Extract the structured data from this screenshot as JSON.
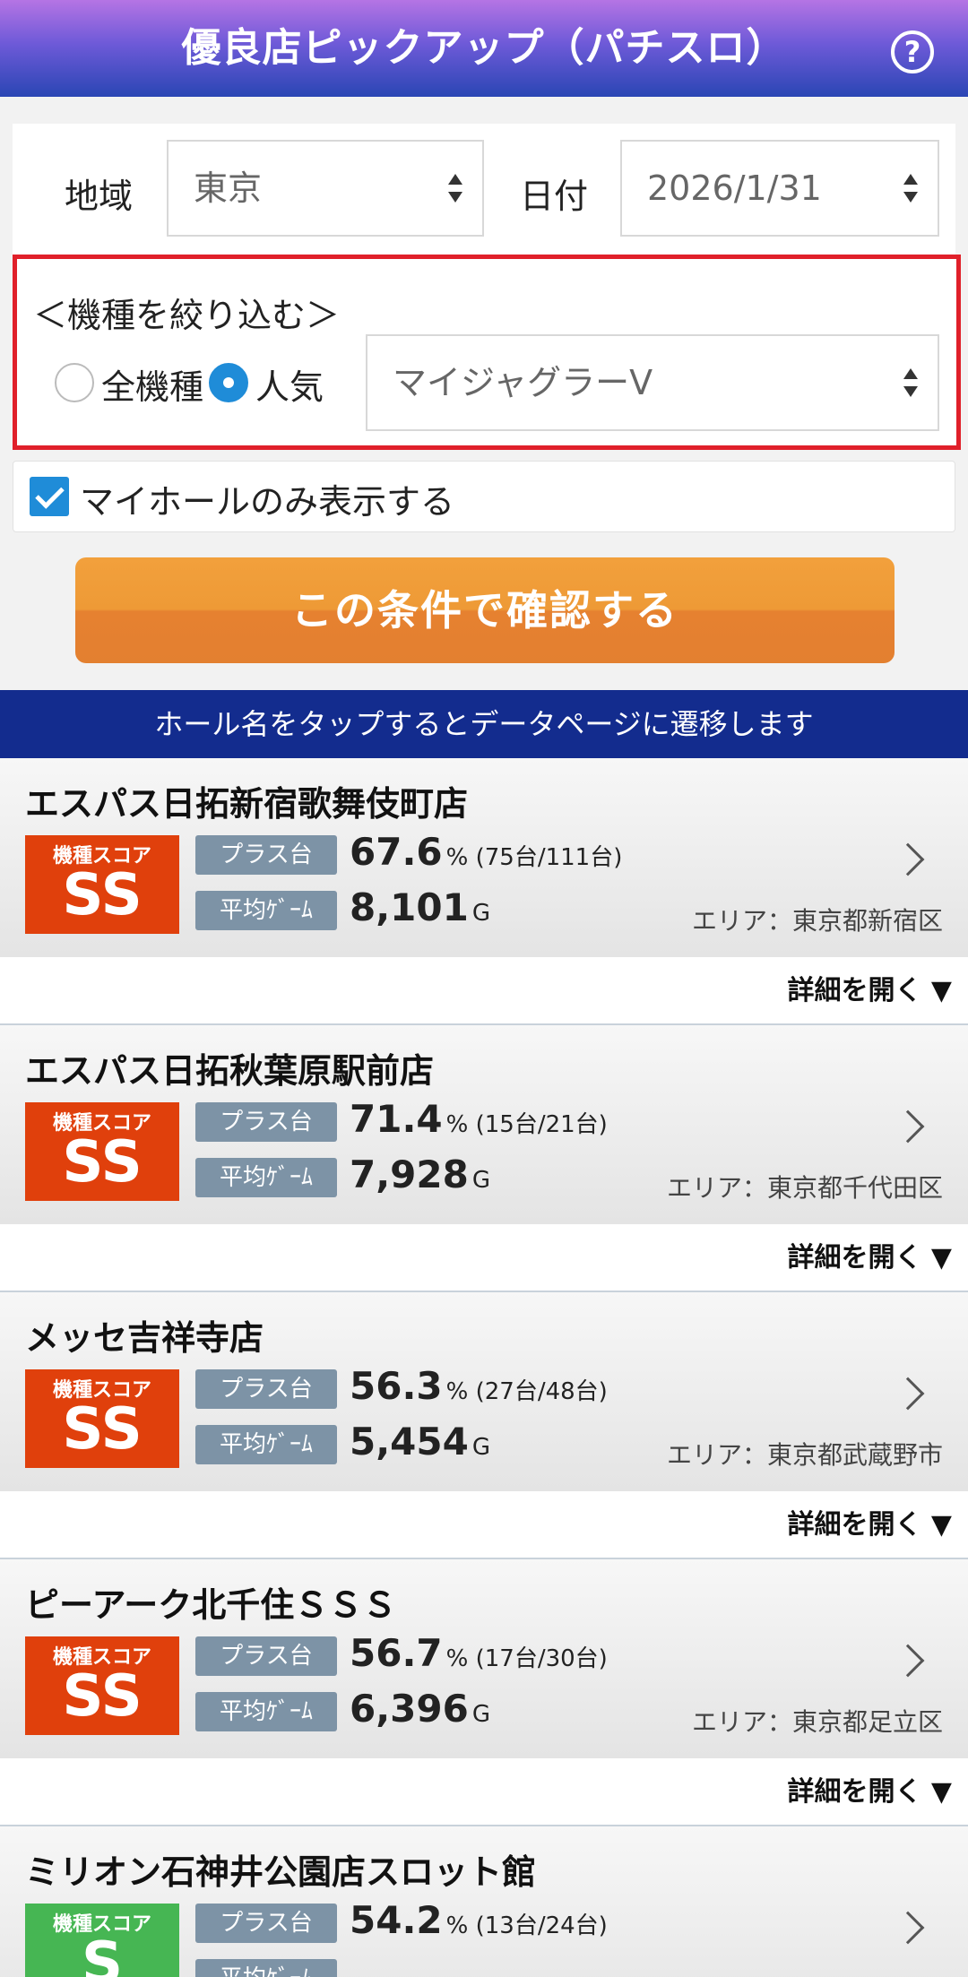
{
  "header": {
    "title": "優良店ピックアップ（パチスロ）",
    "help": "?"
  },
  "filters": {
    "region_label": "地域",
    "region_value": "東京",
    "date_label": "日付",
    "date_value": "2026/1/31",
    "narrow_label": "＜機種を絞り込む＞",
    "radio_all": "全機種",
    "radio_popular": "人気",
    "machine_value": "マイジャグラーV",
    "myhall_label": "マイホールのみ表示する"
  },
  "confirm_button": "この条件で確認する",
  "banner": "ホール名をタップするとデータページに遷移します",
  "labels": {
    "plus": "プラス台",
    "avg": "平均ｹﾞｰﾑ",
    "score_caption": "機種スコア",
    "detail": "詳細を開く ▼",
    "pct_unit": "%",
    "game_unit": "G"
  },
  "colors": {
    "ss": "#e0400c",
    "s": "#46b653"
  },
  "halls": [
    {
      "name": "エスパス日拓新宿歌舞伎町店",
      "grade": "SS",
      "pct": "67.6",
      "count": "(75台/111台)",
      "avg": "8,101",
      "area": "エリア：東京都新宿区"
    },
    {
      "name": "エスパス日拓秋葉原駅前店",
      "grade": "SS",
      "pct": "71.4",
      "count": "(15台/21台)",
      "avg": "7,928",
      "area": "エリア：東京都千代田区"
    },
    {
      "name": "メッセ吉祥寺店",
      "grade": "SS",
      "pct": "56.3",
      "count": "(27台/48台)",
      "avg": "5,454",
      "area": "エリア：東京都武蔵野市"
    },
    {
      "name": "ピーアーク北千住ＳＳＳ",
      "grade": "SS",
      "pct": "56.7",
      "count": "(17台/30台)",
      "avg": "6,396",
      "area": "エリア：東京都足立区"
    },
    {
      "name": "ミリオン石神井公園店スロット館",
      "grade": "S",
      "pct": "54.2",
      "count": "(13台/24台)",
      "avg": "",
      "area": ""
    }
  ]
}
